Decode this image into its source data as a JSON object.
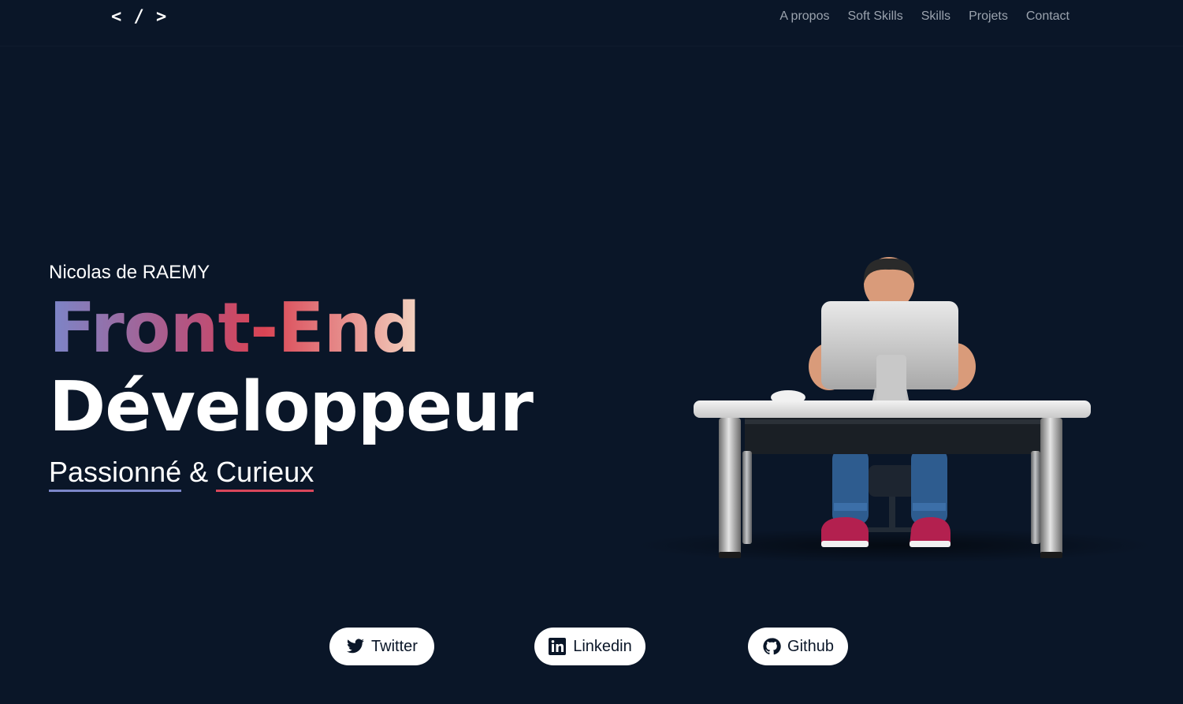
{
  "nav": {
    "logo": "< / >",
    "links": [
      "A propos",
      "Soft Skills",
      "Skills",
      "Projets",
      "Contact"
    ]
  },
  "hero": {
    "name": "Nicolas de RAEMY",
    "title_line1": "Front-End",
    "title_line2": "Développeur",
    "tag_word1": "Passionné",
    "tag_amp": "&",
    "tag_word2": "Curieux"
  },
  "social": {
    "twitter": "Twitter",
    "linkedin": "Linkedin",
    "github": "Github"
  },
  "icons": [
    "twitter-icon",
    "linkedin-icon",
    "github-icon"
  ],
  "colors": {
    "background": "#0a1628",
    "gradient": [
      "#7b86c9",
      "#b8517c",
      "#d94454",
      "#f3d4c1"
    ],
    "underline_passionne": "#7b86c9",
    "underline_curieux": "#d9475b"
  }
}
